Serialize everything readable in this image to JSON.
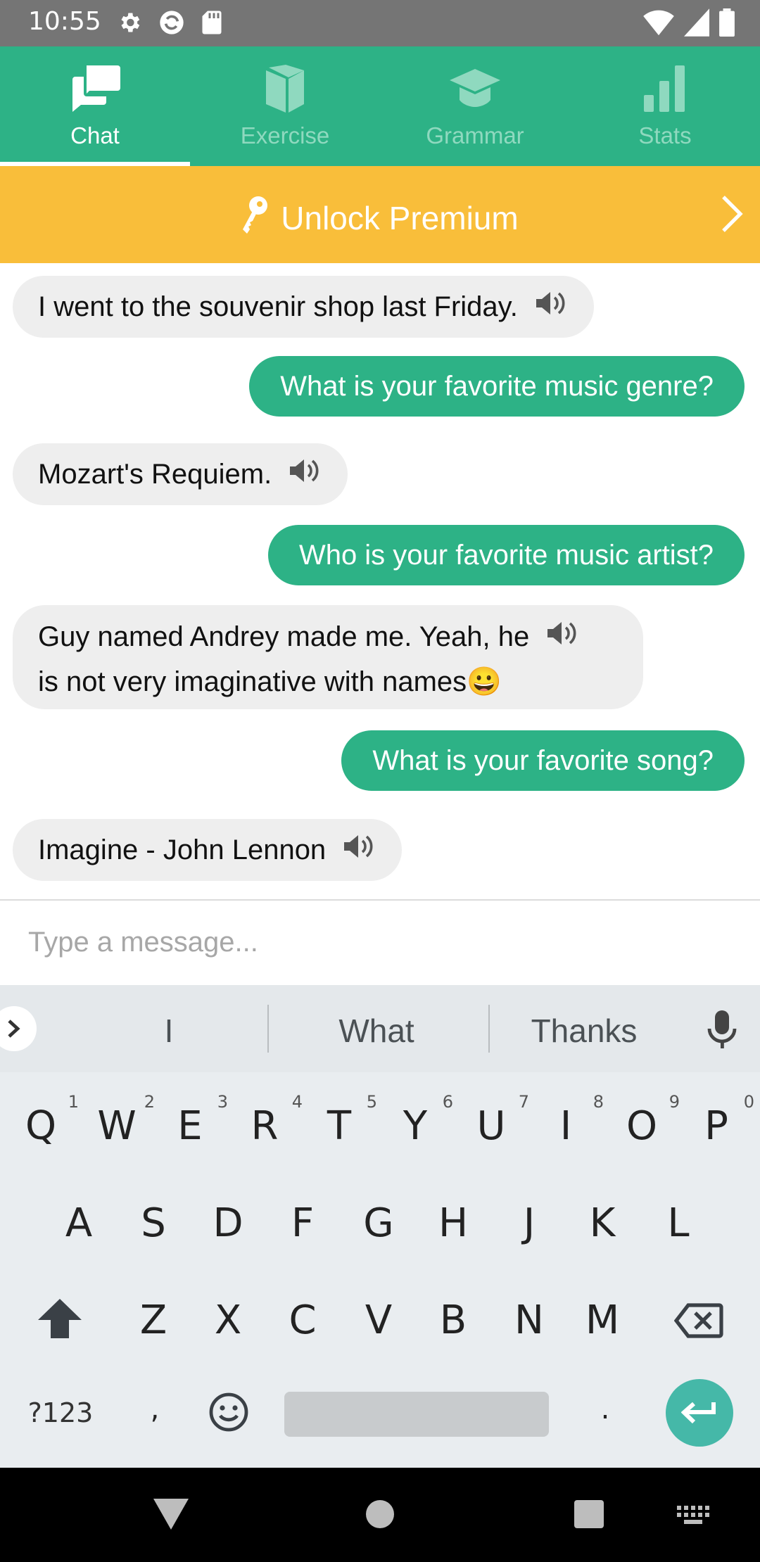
{
  "status_bar": {
    "time": "10:55"
  },
  "tabs": [
    {
      "label": "Chat",
      "icon": "chat-icon",
      "active": true
    },
    {
      "label": "Exercise",
      "icon": "book-icon",
      "active": false
    },
    {
      "label": "Grammar",
      "icon": "graduation-cap-icon",
      "active": false
    },
    {
      "label": "Stats",
      "icon": "bar-chart-icon",
      "active": false
    }
  ],
  "premium_banner": {
    "label": "Unlock Premium"
  },
  "messages": [
    {
      "from": "bot",
      "text": "I went to the souvenir shop last Friday."
    },
    {
      "from": "user",
      "text": "What is your favorite music genre?"
    },
    {
      "from": "bot",
      "text": "Mozart's Requiem."
    },
    {
      "from": "user",
      "text": "Who is your favorite music artist?"
    },
    {
      "from": "bot",
      "text_line1": "Guy named Andrey made me. Yeah, he",
      "text_line2": "is not very imaginative with names😀"
    },
    {
      "from": "user",
      "text": "What is your favorite song?"
    },
    {
      "from": "bot",
      "text": "Imagine - John Lennon"
    }
  ],
  "composer": {
    "placeholder": "Type a message..."
  },
  "keyboard": {
    "suggestions": [
      "I",
      "What",
      "Thanks"
    ],
    "row1": [
      "Q",
      "W",
      "E",
      "R",
      "T",
      "Y",
      "U",
      "I",
      "O",
      "P"
    ],
    "row1_hints": [
      "1",
      "2",
      "3",
      "4",
      "5",
      "6",
      "7",
      "8",
      "9",
      "0"
    ],
    "row2": [
      "A",
      "S",
      "D",
      "F",
      "G",
      "H",
      "J",
      "K",
      "L"
    ],
    "row3": [
      "Z",
      "X",
      "C",
      "V",
      "B",
      "N",
      "M"
    ],
    "symbols_label": "?123",
    "comma": ",",
    "period": "."
  },
  "colors": {
    "accent": "#2db286",
    "premium": "#f9be3a",
    "status_bar": "#757575"
  }
}
